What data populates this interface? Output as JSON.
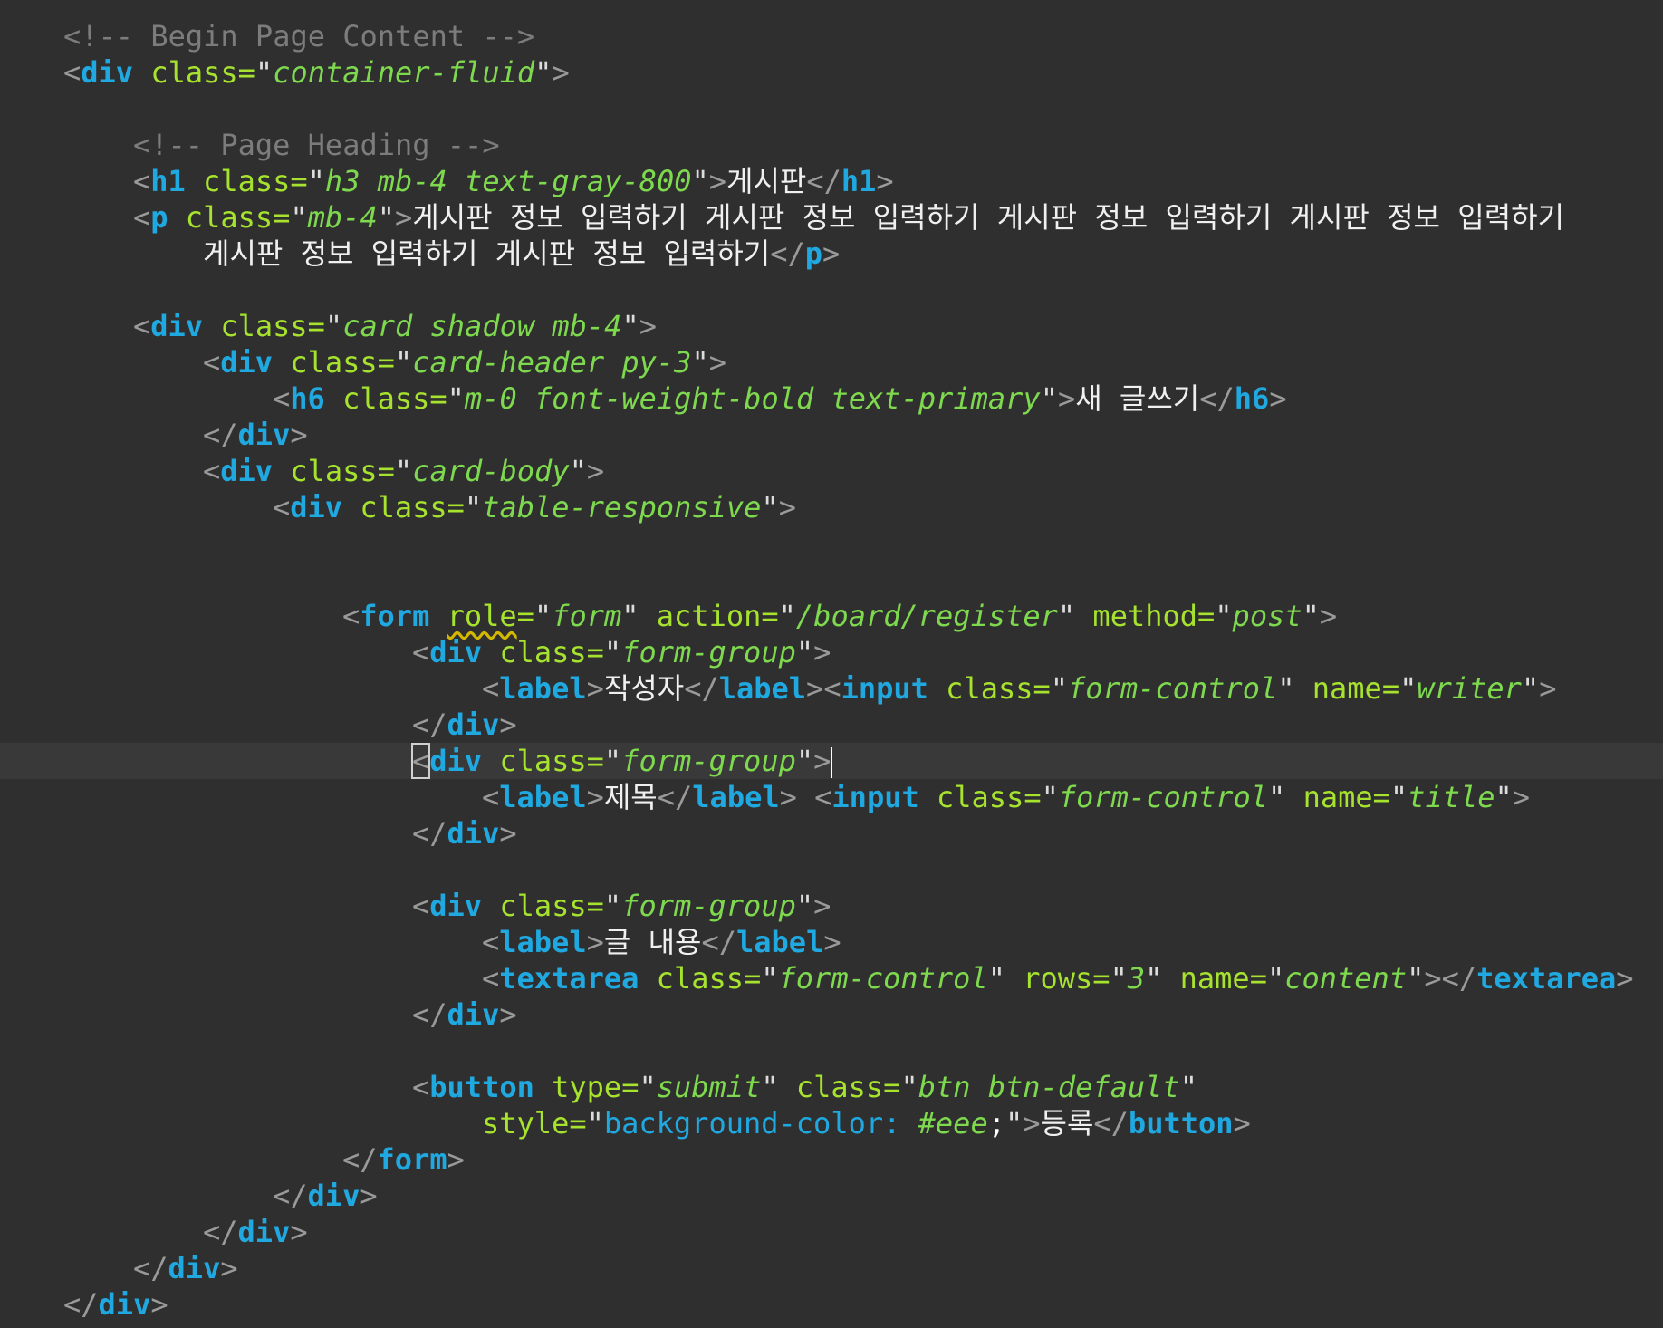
{
  "editor": {
    "lines": [
      {
        "indent": 1,
        "tokens": [
          {
            "k": "c",
            "s": "<!-- Begin Page Content -->"
          }
        ]
      },
      {
        "indent": 1,
        "tokens": [
          {
            "k": "p",
            "s": "<"
          },
          {
            "k": "tg",
            "s": "div"
          },
          {
            "k": "at",
            "s": " class"
          },
          {
            "k": "eq",
            "s": "="
          },
          {
            "k": "q",
            "s": "\""
          },
          {
            "k": "v",
            "s": "container-fluid"
          },
          {
            "k": "q",
            "s": "\""
          },
          {
            "k": "p",
            "s": ">"
          }
        ]
      },
      {
        "indent": 0,
        "tokens": []
      },
      {
        "indent": 2,
        "tokens": [
          {
            "k": "c",
            "s": "<!-- Page Heading -->"
          }
        ]
      },
      {
        "indent": 2,
        "tokens": [
          {
            "k": "p",
            "s": "<"
          },
          {
            "k": "tg",
            "s": "h1"
          },
          {
            "k": "at",
            "s": " class"
          },
          {
            "k": "eq",
            "s": "="
          },
          {
            "k": "q",
            "s": "\""
          },
          {
            "k": "v",
            "s": "h3 mb-4 text-gray-800"
          },
          {
            "k": "q",
            "s": "\""
          },
          {
            "k": "p",
            "s": ">"
          },
          {
            "k": "tx",
            "s": "게시판"
          },
          {
            "k": "p",
            "s": "</"
          },
          {
            "k": "tg",
            "s": "h1"
          },
          {
            "k": "p",
            "s": ">"
          }
        ]
      },
      {
        "indent": 2,
        "tokens": [
          {
            "k": "p",
            "s": "<"
          },
          {
            "k": "tg",
            "s": "p"
          },
          {
            "k": "at",
            "s": " class"
          },
          {
            "k": "eq",
            "s": "="
          },
          {
            "k": "q",
            "s": "\""
          },
          {
            "k": "v",
            "s": "mb-4"
          },
          {
            "k": "q",
            "s": "\""
          },
          {
            "k": "p",
            "s": ">"
          },
          {
            "k": "tx",
            "s": "게시판 정보 입력하기 게시판 정보 입력하기 게시판 정보 입력하기 게시판 정보 입력하기"
          }
        ]
      },
      {
        "indent": 3,
        "tokens": [
          {
            "k": "tx",
            "s": "게시판 정보 입력하기 게시판 정보 입력하기"
          },
          {
            "k": "p",
            "s": "</"
          },
          {
            "k": "tg",
            "s": "p"
          },
          {
            "k": "p",
            "s": ">"
          }
        ]
      },
      {
        "indent": 0,
        "tokens": []
      },
      {
        "indent": 2,
        "tokens": [
          {
            "k": "p",
            "s": "<"
          },
          {
            "k": "tg",
            "s": "div"
          },
          {
            "k": "at",
            "s": " class"
          },
          {
            "k": "eq",
            "s": "="
          },
          {
            "k": "q",
            "s": "\""
          },
          {
            "k": "v",
            "s": "card shadow mb-4"
          },
          {
            "k": "q",
            "s": "\""
          },
          {
            "k": "p",
            "s": ">"
          }
        ]
      },
      {
        "indent": 3,
        "tokens": [
          {
            "k": "p",
            "s": "<"
          },
          {
            "k": "tg",
            "s": "div"
          },
          {
            "k": "at",
            "s": " class"
          },
          {
            "k": "eq",
            "s": "="
          },
          {
            "k": "q",
            "s": "\""
          },
          {
            "k": "v",
            "s": "card-header py-3"
          },
          {
            "k": "q",
            "s": "\""
          },
          {
            "k": "p",
            "s": ">"
          }
        ]
      },
      {
        "indent": 4,
        "tokens": [
          {
            "k": "p",
            "s": "<"
          },
          {
            "k": "tg",
            "s": "h6"
          },
          {
            "k": "at",
            "s": " class"
          },
          {
            "k": "eq",
            "s": "="
          },
          {
            "k": "q",
            "s": "\""
          },
          {
            "k": "v",
            "s": "m-0 font-weight-bold text-primary"
          },
          {
            "k": "q",
            "s": "\""
          },
          {
            "k": "p",
            "s": ">"
          },
          {
            "k": "tx",
            "s": "새 글쓰기"
          },
          {
            "k": "p",
            "s": "</"
          },
          {
            "k": "tg",
            "s": "h6"
          },
          {
            "k": "p",
            "s": ">"
          }
        ]
      },
      {
        "indent": 3,
        "tokens": [
          {
            "k": "p",
            "s": "</"
          },
          {
            "k": "tg",
            "s": "div"
          },
          {
            "k": "p",
            "s": ">"
          }
        ]
      },
      {
        "indent": 3,
        "tokens": [
          {
            "k": "p",
            "s": "<"
          },
          {
            "k": "tg",
            "s": "div"
          },
          {
            "k": "at",
            "s": " class"
          },
          {
            "k": "eq",
            "s": "="
          },
          {
            "k": "q",
            "s": "\""
          },
          {
            "k": "v",
            "s": "card-body"
          },
          {
            "k": "q",
            "s": "\""
          },
          {
            "k": "p",
            "s": ">"
          }
        ]
      },
      {
        "indent": 4,
        "tokens": [
          {
            "k": "p",
            "s": "<"
          },
          {
            "k": "tg",
            "s": "div"
          },
          {
            "k": "at",
            "s": " class"
          },
          {
            "k": "eq",
            "s": "="
          },
          {
            "k": "q",
            "s": "\""
          },
          {
            "k": "v",
            "s": "table-responsive"
          },
          {
            "k": "q",
            "s": "\""
          },
          {
            "k": "p",
            "s": ">"
          }
        ]
      },
      {
        "indent": 0,
        "tokens": []
      },
      {
        "indent": 0,
        "tokens": []
      },
      {
        "indent": 5,
        "tokens": [
          {
            "k": "p",
            "s": "<"
          },
          {
            "k": "tg",
            "s": "form"
          },
          {
            "k": "at",
            "s": " "
          },
          {
            "k": "at squiggle",
            "s": "role"
          },
          {
            "k": "eq",
            "s": "="
          },
          {
            "k": "q",
            "s": "\""
          },
          {
            "k": "v",
            "s": "form"
          },
          {
            "k": "q",
            "s": "\""
          },
          {
            "k": "at",
            "s": " action"
          },
          {
            "k": "eq",
            "s": "="
          },
          {
            "k": "q",
            "s": "\""
          },
          {
            "k": "v",
            "s": "/board/register"
          },
          {
            "k": "q",
            "s": "\""
          },
          {
            "k": "at",
            "s": " method"
          },
          {
            "k": "eq",
            "s": "="
          },
          {
            "k": "q",
            "s": "\""
          },
          {
            "k": "v",
            "s": "post"
          },
          {
            "k": "q",
            "s": "\""
          },
          {
            "k": "p",
            "s": ">"
          }
        ]
      },
      {
        "indent": 6,
        "tokens": [
          {
            "k": "p",
            "s": "<"
          },
          {
            "k": "tg",
            "s": "div"
          },
          {
            "k": "at",
            "s": " class"
          },
          {
            "k": "eq",
            "s": "="
          },
          {
            "k": "q",
            "s": "\""
          },
          {
            "k": "v",
            "s": "form-group"
          },
          {
            "k": "q",
            "s": "\""
          },
          {
            "k": "p",
            "s": ">"
          }
        ]
      },
      {
        "indent": 7,
        "tokens": [
          {
            "k": "p",
            "s": "<"
          },
          {
            "k": "tg",
            "s": "label"
          },
          {
            "k": "p",
            "s": ">"
          },
          {
            "k": "tx",
            "s": "작성자"
          },
          {
            "k": "p",
            "s": "</"
          },
          {
            "k": "tg",
            "s": "label"
          },
          {
            "k": "p",
            "s": "><"
          },
          {
            "k": "tg",
            "s": "input"
          },
          {
            "k": "at",
            "s": " class"
          },
          {
            "k": "eq",
            "s": "="
          },
          {
            "k": "q",
            "s": "\""
          },
          {
            "k": "v",
            "s": "form-control"
          },
          {
            "k": "q",
            "s": "\""
          },
          {
            "k": "at",
            "s": " name"
          },
          {
            "k": "eq",
            "s": "="
          },
          {
            "k": "q",
            "s": "\""
          },
          {
            "k": "v",
            "s": "writer"
          },
          {
            "k": "q",
            "s": "\""
          },
          {
            "k": "p",
            "s": ">"
          }
        ]
      },
      {
        "indent": 6,
        "tokens": [
          {
            "k": "p",
            "s": "</"
          },
          {
            "k": "tg",
            "s": "div"
          },
          {
            "k": "p",
            "s": ">"
          }
        ]
      },
      {
        "indent": 6,
        "current": true,
        "tokens": [
          {
            "k": "p bracket-hl",
            "s": "<"
          },
          {
            "k": "tg",
            "s": "div"
          },
          {
            "k": "at",
            "s": " class"
          },
          {
            "k": "eq",
            "s": "="
          },
          {
            "k": "q",
            "s": "\""
          },
          {
            "k": "v",
            "s": "form-group"
          },
          {
            "k": "q",
            "s": "\""
          },
          {
            "k": "p",
            "s": ">"
          },
          {
            "k": "caret",
            "s": ""
          }
        ]
      },
      {
        "indent": 7,
        "tokens": [
          {
            "k": "p",
            "s": "<"
          },
          {
            "k": "tg",
            "s": "label"
          },
          {
            "k": "p",
            "s": ">"
          },
          {
            "k": "tx",
            "s": "제목"
          },
          {
            "k": "p",
            "s": "</"
          },
          {
            "k": "tg",
            "s": "label"
          },
          {
            "k": "p",
            "s": "> <"
          },
          {
            "k": "tg",
            "s": "input"
          },
          {
            "k": "at",
            "s": " class"
          },
          {
            "k": "eq",
            "s": "="
          },
          {
            "k": "q",
            "s": "\""
          },
          {
            "k": "v",
            "s": "form-control"
          },
          {
            "k": "q",
            "s": "\""
          },
          {
            "k": "at",
            "s": " name"
          },
          {
            "k": "eq",
            "s": "="
          },
          {
            "k": "q",
            "s": "\""
          },
          {
            "k": "v",
            "s": "title"
          },
          {
            "k": "q",
            "s": "\""
          },
          {
            "k": "p",
            "s": ">"
          }
        ]
      },
      {
        "indent": 6,
        "tokens": [
          {
            "k": "p",
            "s": "</"
          },
          {
            "k": "tg",
            "s": "div"
          },
          {
            "k": "p",
            "s": ">"
          }
        ]
      },
      {
        "indent": 0,
        "tokens": []
      },
      {
        "indent": 6,
        "tokens": [
          {
            "k": "p",
            "s": "<"
          },
          {
            "k": "tg",
            "s": "div"
          },
          {
            "k": "at",
            "s": " class"
          },
          {
            "k": "eq",
            "s": "="
          },
          {
            "k": "q",
            "s": "\""
          },
          {
            "k": "v",
            "s": "form-group"
          },
          {
            "k": "q",
            "s": "\""
          },
          {
            "k": "p",
            "s": ">"
          }
        ]
      },
      {
        "indent": 7,
        "tokens": [
          {
            "k": "p",
            "s": "<"
          },
          {
            "k": "tg",
            "s": "label"
          },
          {
            "k": "p",
            "s": ">"
          },
          {
            "k": "tx",
            "s": "글 내용"
          },
          {
            "k": "p",
            "s": "</"
          },
          {
            "k": "tg",
            "s": "label"
          },
          {
            "k": "p",
            "s": ">"
          }
        ]
      },
      {
        "indent": 7,
        "tokens": [
          {
            "k": "p",
            "s": "<"
          },
          {
            "k": "tg",
            "s": "textarea"
          },
          {
            "k": "at",
            "s": " class"
          },
          {
            "k": "eq",
            "s": "="
          },
          {
            "k": "q",
            "s": "\""
          },
          {
            "k": "v",
            "s": "form-control"
          },
          {
            "k": "q",
            "s": "\""
          },
          {
            "k": "at",
            "s": " rows"
          },
          {
            "k": "eq",
            "s": "="
          },
          {
            "k": "q",
            "s": "\""
          },
          {
            "k": "v",
            "s": "3"
          },
          {
            "k": "q",
            "s": "\""
          },
          {
            "k": "at",
            "s": " name"
          },
          {
            "k": "eq",
            "s": "="
          },
          {
            "k": "q",
            "s": "\""
          },
          {
            "k": "v",
            "s": "content"
          },
          {
            "k": "q",
            "s": "\""
          },
          {
            "k": "p",
            "s": "></"
          },
          {
            "k": "tg",
            "s": "textarea"
          },
          {
            "k": "p",
            "s": ">"
          }
        ]
      },
      {
        "indent": 6,
        "tokens": [
          {
            "k": "p",
            "s": "</"
          },
          {
            "k": "tg",
            "s": "div"
          },
          {
            "k": "p",
            "s": ">"
          }
        ]
      },
      {
        "indent": 0,
        "tokens": []
      },
      {
        "indent": 6,
        "tokens": [
          {
            "k": "p",
            "s": "<"
          },
          {
            "k": "tg",
            "s": "button"
          },
          {
            "k": "at",
            "s": " type"
          },
          {
            "k": "eq",
            "s": "="
          },
          {
            "k": "q",
            "s": "\""
          },
          {
            "k": "v",
            "s": "submit"
          },
          {
            "k": "q",
            "s": "\""
          },
          {
            "k": "at",
            "s": " class"
          },
          {
            "k": "eq",
            "s": "="
          },
          {
            "k": "q",
            "s": "\""
          },
          {
            "k": "v",
            "s": "btn btn-default"
          },
          {
            "k": "q",
            "s": "\""
          }
        ]
      },
      {
        "indent": 7,
        "tokens": [
          {
            "k": "at",
            "s": "style"
          },
          {
            "k": "eq",
            "s": "="
          },
          {
            "k": "q",
            "s": "\""
          },
          {
            "k": "sp",
            "s": "background-color: "
          },
          {
            "k": "sv",
            "s": "#eee"
          },
          {
            "k": "semi",
            "s": ";"
          },
          {
            "k": "q",
            "s": "\""
          },
          {
            "k": "p",
            "s": ">"
          },
          {
            "k": "tx",
            "s": "등록"
          },
          {
            "k": "p",
            "s": "</"
          },
          {
            "k": "tg",
            "s": "button"
          },
          {
            "k": "p",
            "s": ">"
          }
        ]
      },
      {
        "indent": 5,
        "tokens": [
          {
            "k": "p",
            "s": "</"
          },
          {
            "k": "tg",
            "s": "form"
          },
          {
            "k": "p",
            "s": ">"
          }
        ]
      },
      {
        "indent": 4,
        "tokens": [
          {
            "k": "p",
            "s": "</"
          },
          {
            "k": "tg",
            "s": "div"
          },
          {
            "k": "p",
            "s": ">"
          }
        ]
      },
      {
        "indent": 3,
        "tokens": [
          {
            "k": "p",
            "s": "</"
          },
          {
            "k": "tg",
            "s": "div"
          },
          {
            "k": "p",
            "s": ">"
          }
        ]
      },
      {
        "indent": 2,
        "tokens": [
          {
            "k": "p",
            "s": "</"
          },
          {
            "k": "tg",
            "s": "div"
          },
          {
            "k": "p",
            "s": ">"
          }
        ]
      },
      {
        "indent": 1,
        "tokens": [
          {
            "k": "p",
            "s": "</"
          },
          {
            "k": "tg",
            "s": "div"
          },
          {
            "k": "p",
            "s": ">"
          }
        ]
      }
    ]
  }
}
